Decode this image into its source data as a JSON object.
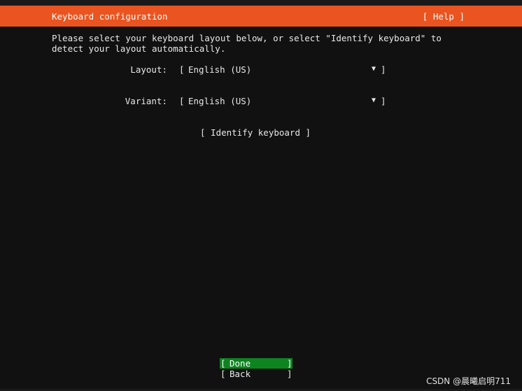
{
  "header": {
    "title": "Keyboard configuration",
    "help": "[ Help ]"
  },
  "instructions": "Please select your keyboard layout below, or select \"Identify keyboard\" to\ndetect your layout automatically.",
  "layout": {
    "label": "Layout:",
    "value": "English (US)"
  },
  "variant": {
    "label": "Variant:",
    "value": "English (US)"
  },
  "select_glyphs": {
    "open": "[",
    "close": "]",
    "arrow": "▼"
  },
  "identify_button": "[ Identify keyboard ]",
  "buttons": {
    "done": "Done",
    "back": "Back"
  },
  "watermark": "CSDN @晨曦启明711",
  "colors": {
    "header_bg": "#e95420",
    "primary_button_bg": "#0e8420",
    "background": "#111111"
  }
}
